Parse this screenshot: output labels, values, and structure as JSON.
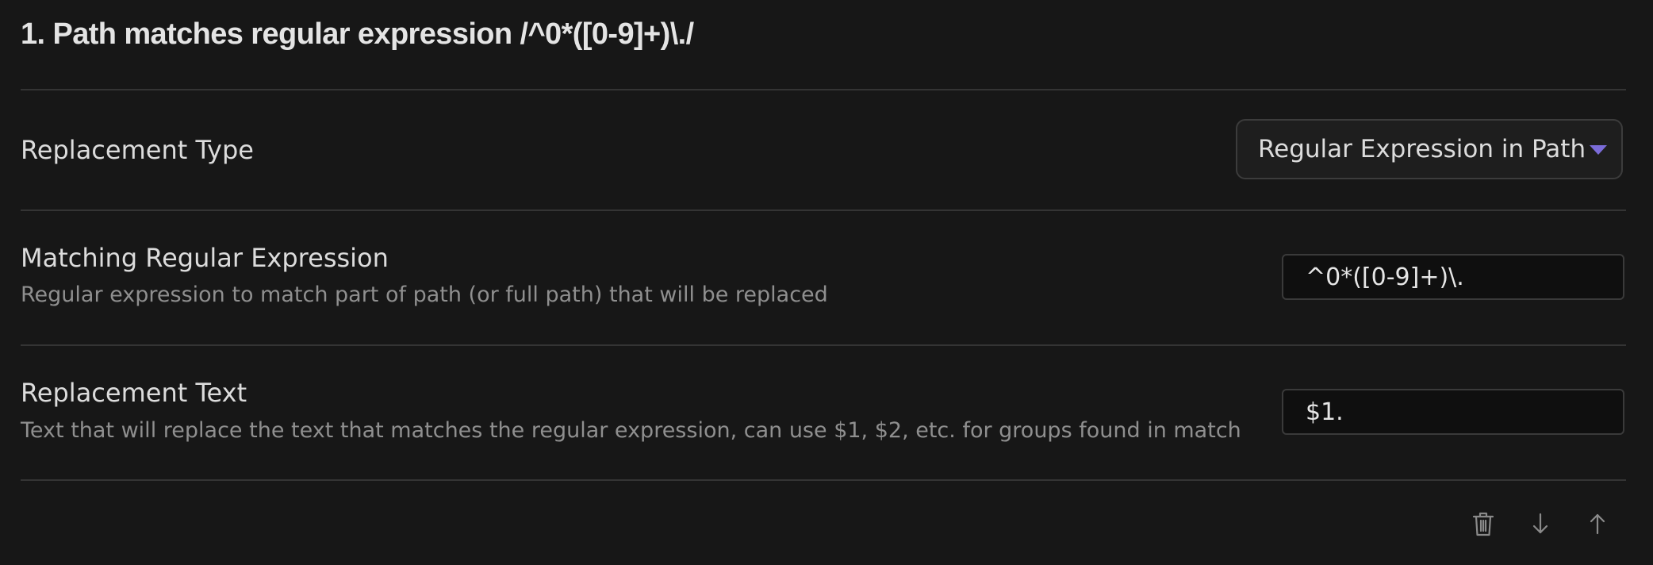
{
  "rule": {
    "heading": "1. Path matches regular expression /^0*([0-9]+)\\./"
  },
  "settings": {
    "replacement_type": {
      "name": "Replacement Type",
      "selected": "Regular Expression in Path"
    },
    "matching_regex": {
      "name": "Matching Regular Expression",
      "description": "Regular expression to match part of path (or full path) that will be replaced",
      "value": "^0*([0-9]+)\\."
    },
    "replacement_text": {
      "name": "Replacement Text",
      "description": "Text that will replace the text that matches the regular expression, can use $1, $2, etc. for groups found in match",
      "value": "$1."
    }
  },
  "actions": {
    "delete_icon": "trash-icon",
    "move_down_icon": "arrow-down-icon",
    "move_up_icon": "arrow-up-icon"
  },
  "colors": {
    "background": "#171717",
    "accent": "#7b6cd9",
    "text": "#dcdcdc",
    "muted": "#8f8f8f",
    "divider": "#343434"
  }
}
